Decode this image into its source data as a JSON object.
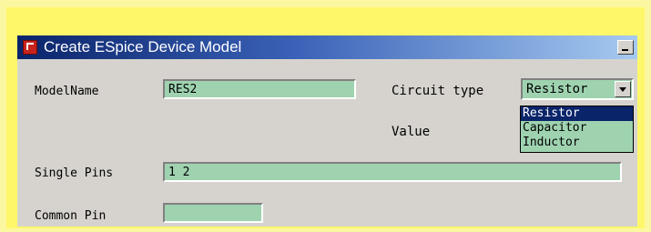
{
  "window": {
    "title": "Create ESpice Device Model"
  },
  "form": {
    "model_name_label": "ModelName",
    "model_name_value": "RES2",
    "circuit_type_label": "Circuit type",
    "circuit_type_selected": "Resistor",
    "circuit_type_options": [
      "Resistor",
      "Capacitor",
      "Inductor"
    ],
    "value_label": "Value",
    "single_pins_label": "Single Pins",
    "single_pins_value": "1 2",
    "common_pin_label": "Common Pin",
    "common_pin_value": ""
  },
  "colors": {
    "frame": "#fff76a",
    "field_bg": "#9fd3b0",
    "window_bg": "#d6d3ce",
    "selection": "#0a246a"
  },
  "icons": [
    "app-icon",
    "minimize-icon",
    "dropdown-arrow-icon"
  ]
}
